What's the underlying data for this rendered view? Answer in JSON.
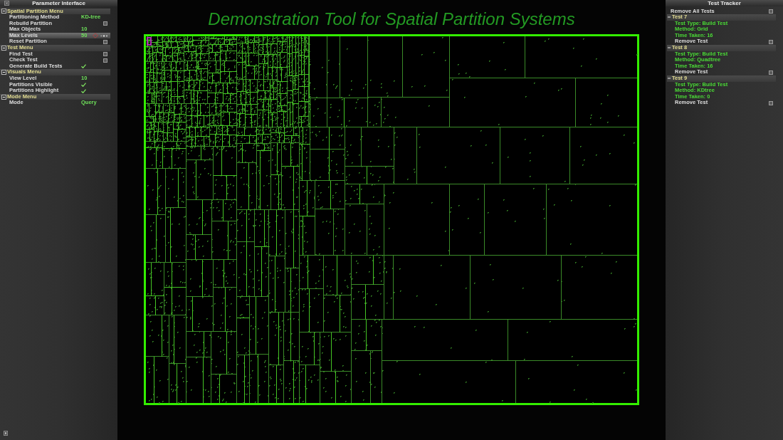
{
  "parameter_panel": {
    "title": "Parameter Interface",
    "menus": [
      {
        "title": "Spatial Partition Menu",
        "expanded": true,
        "items": [
          {
            "kind": "value",
            "label": "Partitioning Method",
            "value": "KD-tree",
            "selected": false
          },
          {
            "kind": "button",
            "label": "Rebuild Partition",
            "selected": false
          },
          {
            "kind": "value",
            "label": "Max Objects",
            "value": "10",
            "selected": false
          },
          {
            "kind": "stepper",
            "label": "Max Levels",
            "value": "50",
            "selected": true
          },
          {
            "kind": "button",
            "label": "Reset Partition",
            "selected": false
          }
        ]
      },
      {
        "title": "Test Menu",
        "expanded": true,
        "items": [
          {
            "kind": "button",
            "label": "Find Test",
            "selected": false
          },
          {
            "kind": "button",
            "label": "Check Test",
            "selected": false
          },
          {
            "kind": "toggle",
            "label": "Generate Build Tests",
            "checked": true,
            "selected": false
          }
        ]
      },
      {
        "title": "Visuals Menu",
        "expanded": true,
        "items": [
          {
            "kind": "value",
            "label": "View Level",
            "value": "10",
            "selected": false
          },
          {
            "kind": "toggle",
            "label": "Partitions Visible",
            "checked": true,
            "selected": false
          },
          {
            "kind": "toggle",
            "label": "Partitions Highlight",
            "checked": true,
            "selected": false
          }
        ]
      },
      {
        "title": "Mode Menu",
        "expanded": true,
        "items": [
          {
            "kind": "value",
            "label": "Mode",
            "value": "Query",
            "selected": false
          }
        ]
      }
    ]
  },
  "title": "Demonstration Tool for Spatial Partition Systems",
  "test_tracker": {
    "title": "Test Tracker",
    "remove_all": "Remove All Tests",
    "tests": [
      {
        "name": "Test 7",
        "expanded": true,
        "details": [
          "Test Type: Build Test",
          "Method: Grid",
          "Time Taken: 16"
        ],
        "remove": "Remove Test"
      },
      {
        "name": "Test 8",
        "expanded": true,
        "details": [
          "Test Type: Build Test",
          "Method: Quadtree",
          "Time Taken: 16"
        ],
        "remove": "Remove Test"
      },
      {
        "name": "Test 9",
        "expanded": true,
        "details": [
          "Test Type: Build Test",
          "Method: KDtree",
          "Time Taken: 0"
        ],
        "remove": "Remove Test"
      }
    ]
  }
}
